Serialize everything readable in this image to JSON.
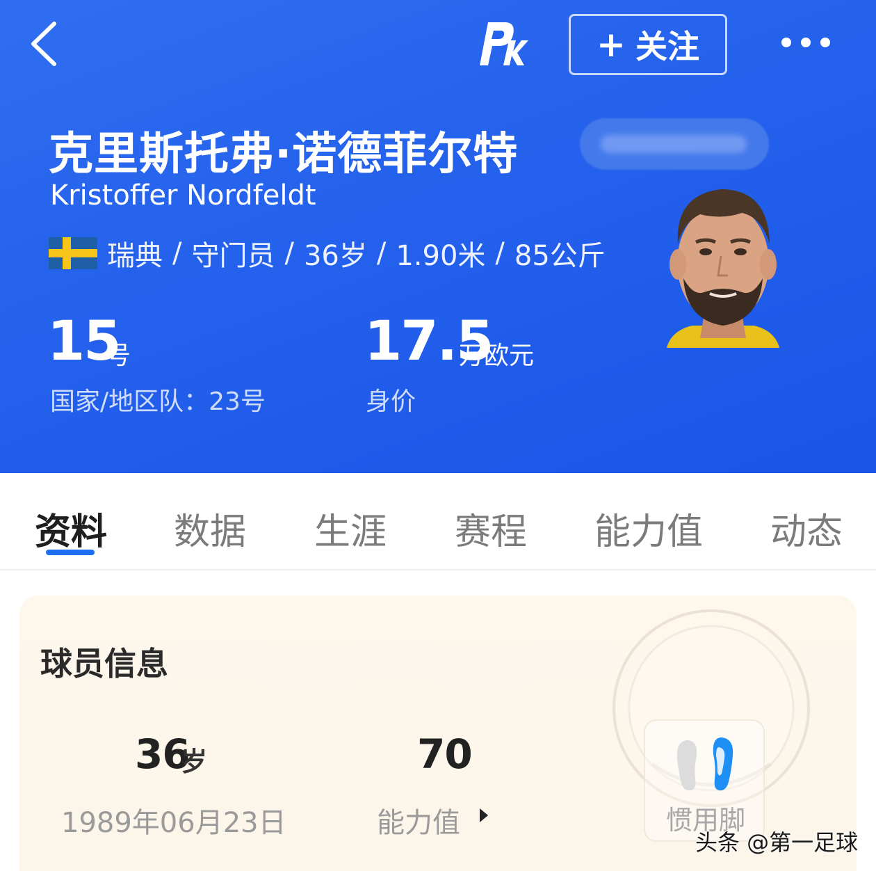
{
  "header": {
    "follow_plus": "+",
    "follow_label": "关注"
  },
  "player": {
    "name_cn": "克里斯托弗·诺德菲尔特",
    "name_en": "Kristoffer Nordfeldt",
    "country": "瑞典",
    "position": "守门员",
    "age": "36岁",
    "height": "1.90米",
    "weight": "85公斤",
    "separator": "/",
    "shirt_number": "15",
    "shirt_unit": "号",
    "national_team_label": "国家/地区队：23号",
    "market_value": "17.5",
    "market_value_unit": "万欧元",
    "market_value_label": "身价"
  },
  "tabs": [
    "资料",
    "数据",
    "生涯",
    "赛程",
    "能力值",
    "动态"
  ],
  "player_info": {
    "title": "球员信息",
    "age_value": "36",
    "age_unit": "岁",
    "birthdate": "1989年06月23日",
    "rating_value": "70",
    "rating_label": "能力值",
    "preferred_foot_label": "惯用脚"
  },
  "watermark": "头条 @第一足球",
  "colors": {
    "header_blue": "#2461ec",
    "tab_accent": "#1e6ff2",
    "flag_blue": "#1e5fa8",
    "flag_yellow": "#f7c51a",
    "card_bg": "#fdf7ec"
  },
  "icons": [
    "back-arrow-icon",
    "pk-logo",
    "more-dots-icon",
    "sweden-flag-icon",
    "player-avatar",
    "foot-icon"
  ]
}
